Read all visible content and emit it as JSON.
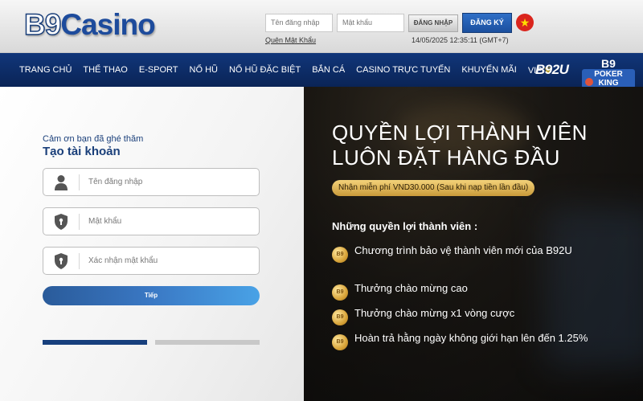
{
  "header": {
    "logo_b9": "B9",
    "logo_casino": "Casino",
    "username_placeholder": "Tên đăng nhập",
    "password_placeholder": "Mật khẩu",
    "login_label": "ĐĂNG NHẬP",
    "register_label": "ĐĂNG KÝ",
    "forgot_label": "Quên Mật Khẩu",
    "datetime": "14/05/2025 12:35:11 (GMT+7)",
    "flag_icon": "vietnam-flag-icon"
  },
  "nav": {
    "items": [
      "TRANG CHỦ",
      "THỂ THAO",
      "E-SPORT",
      "NỔ HŨ",
      "NỔ HŨ ĐẶC BIỆT",
      "BẮN CÁ",
      "CASINO TRỰC TUYẾN",
      "KHUYẾN MÃI",
      "VIP"
    ],
    "brand_b92u": "B92U",
    "brand_pk_top": "B9",
    "brand_pk_bottom": "POKER KING"
  },
  "form": {
    "welcome": "Cảm ơn bạn đã ghé thăm",
    "title": "Tạo tài khoản",
    "username_placeholder": "Tên đăng nhập",
    "password_placeholder": "Mật khẩu",
    "confirm_placeholder": "Xác nhận mật khẩu",
    "next_label": "Tiếp",
    "current_step": 1,
    "total_steps": 2
  },
  "promo": {
    "title_line1": "QUYỀN LỢI THÀNH VIÊN",
    "title_line2": "LUÔN ĐẶT HÀNG ĐẦU",
    "badge": "Nhận miễn phí VND30.000 (Sau khi nạp tiền lần đầu)",
    "benefits_heading": "Những quyền lợi thành viên :",
    "coin_label": "B9",
    "benefits": [
      "Chương trình bảo vệ thành viên mới của B92U",
      "Thưởng chào mừng cao",
      "Thưởng chào mừng x1 vòng cược",
      "Hoàn trả hằng ngày không giới hạn lên đến 1.25%"
    ]
  },
  "colors": {
    "nav_bg": "#0f2f6b",
    "brand_blue": "#1a3f7a",
    "register_button": "#2a66c0",
    "badge_gold": "#e2b859"
  }
}
